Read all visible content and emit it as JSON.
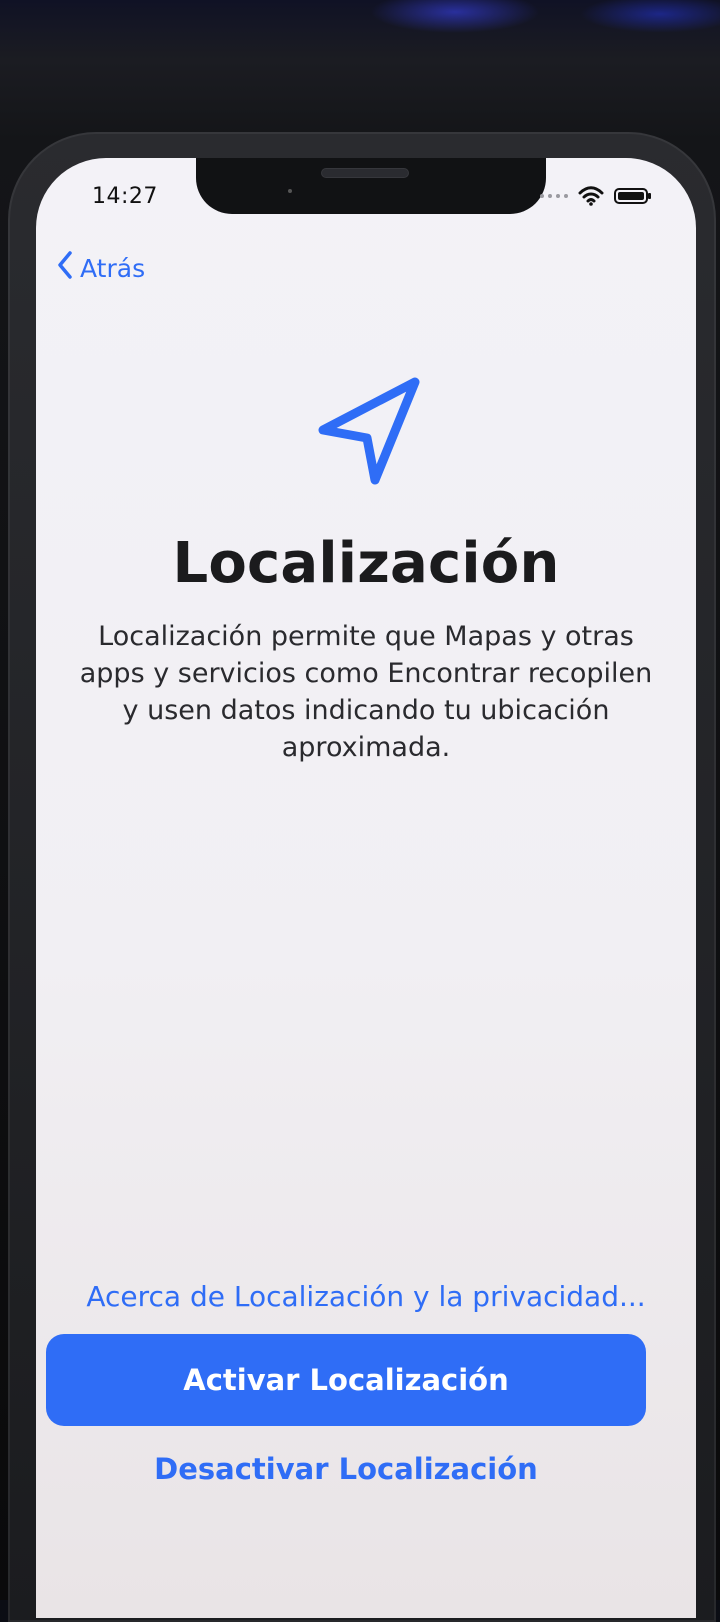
{
  "status_bar": {
    "time": "14:27",
    "icons": [
      "signal-dots-icon",
      "wifi-icon",
      "battery-icon"
    ]
  },
  "nav": {
    "back_label": "Atrás",
    "back_icon": "chevron-left-icon"
  },
  "hero": {
    "icon": "location-arrow-icon",
    "title": "Localización",
    "description": "Localización permite que Mapas y otras apps y servicios como Encontrar recopilen y usen datos indicando tu ubicación aproximada."
  },
  "actions": {
    "privacy_link": "Acerca de Localización y la privacidad...",
    "primary": "Activar Localización",
    "secondary": "Desactivar Localización"
  },
  "colors": {
    "accent": "#2f6df6",
    "screen_bg": "#f3f2f7",
    "text": "#1b1b1d"
  }
}
